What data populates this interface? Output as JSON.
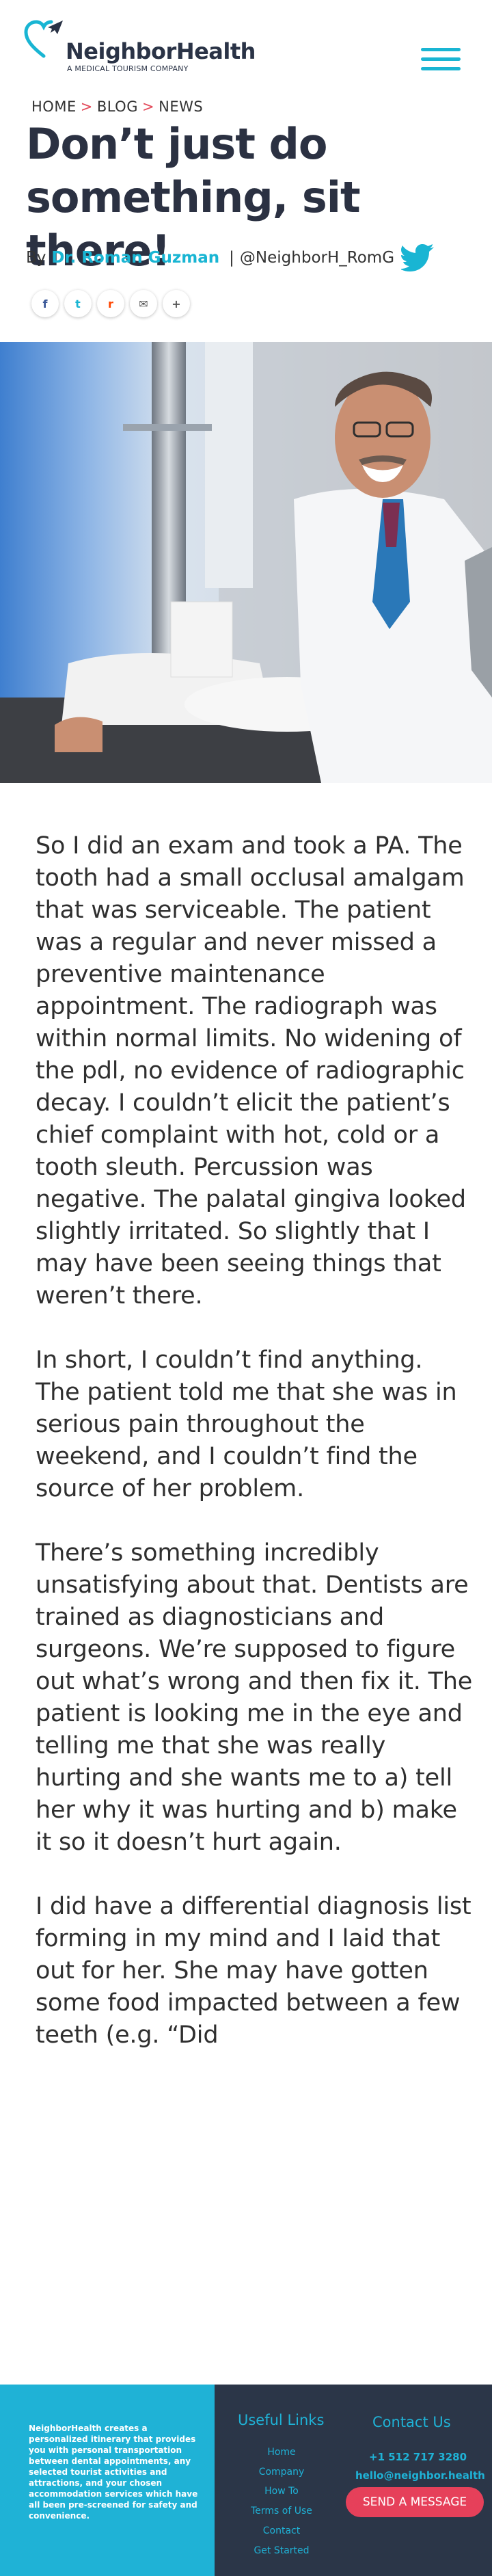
{
  "header": {
    "logo_name_1": "Neighbor",
    "logo_name_2": "Health",
    "logo_tagline": "A MEDICAL TOURISM COMPANY",
    "menu_icon": "hamburger-menu-icon"
  },
  "breadcrumb": {
    "home": "HOME",
    "separator": ">",
    "blog": "BLOG",
    "news": "NEWS"
  },
  "article": {
    "title": "Don’t just do something, sit there!",
    "byline_prefix": "By",
    "author": "Dr. Roman Guzman",
    "separator": "|",
    "twitter_handle": "@NeighborH_RomG",
    "paragraphs": [
      "So I did an exam and took a PA. The tooth had a small occlusal amalgam that was serviceable. The patient was a regular and never missed a preventive maintenance appointment. The radiograph was within normal limits. No widening of the pdl, no evidence of radiographic decay. I couldn’t elicit the patient’s chief complaint with hot, cold or a tooth sleuth. Percussion was negative. The palatal gingiva looked slightly irritated. So slightly that I may have been seeing things that weren’t there.",
      "In short, I couldn’t find anything. The patient told me that she was in serious pain throughout the weekend, and I couldn’t find the source of her problem.",
      "There’s something incredibly unsatisfying about that. Dentists are trained as diagnosticians and surgeons. We’re supposed to figure out what’s wrong and then fix it. The patient is looking me in the eye and telling me that she was really hurting and she wants me to a) tell her why it was hurting and b) make it so it doesn’t hurt again.",
      "I did have a differential diagnosis list forming in my mind and I laid that out for her. She may have gotten some food impacted between a few teeth (e.g. “Did"
    ]
  },
  "share": {
    "facebook": "f",
    "twitter": "t",
    "reddit": "r",
    "email": "✉",
    "more": "+"
  },
  "colors": {
    "brand_blue": "#19b5d3",
    "brand_navy": "#2b3648",
    "accent_red": "#e6405a"
  },
  "footer": {
    "about": "NeighborHealth creates a personalized itinerary that provides you with personal transportation between dental appointments, any selected tourist activities and attractions, and your chosen accommodation services which have all been pre-screened for safety and convenience.",
    "useful_links_title": "Useful Links",
    "links": [
      "Home",
      "Company",
      "How To",
      "Terms of Use",
      "Contact",
      "Get Started"
    ],
    "contact_title": "Contact Us",
    "phone": "+1 512 717 3280",
    "email": "hello@neighbor.health",
    "send_button": "SEND A MESSAGE"
  }
}
